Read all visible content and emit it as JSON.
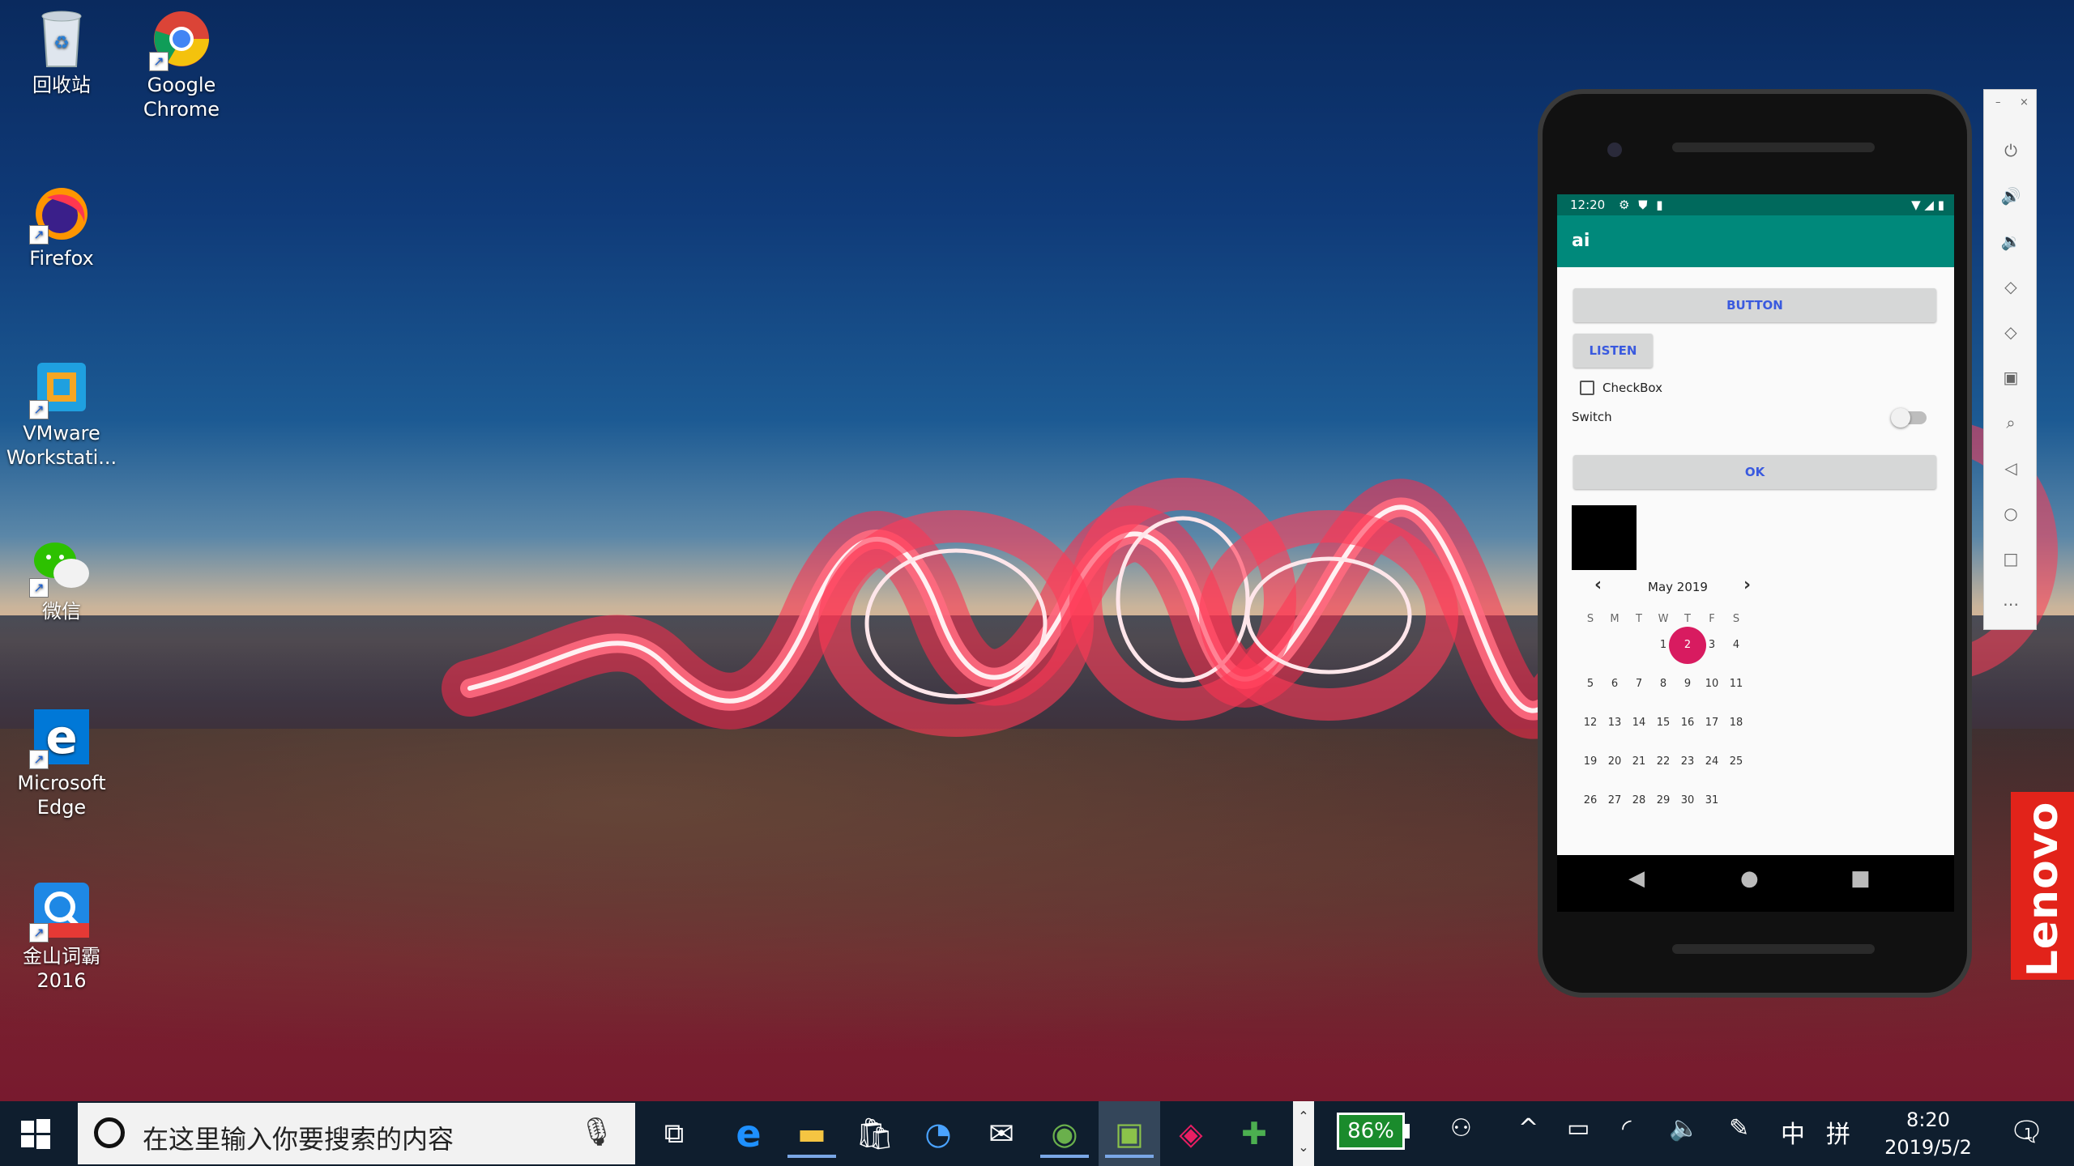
{
  "desktop": {
    "icons": [
      {
        "label": "回收站"
      },
      {
        "label": "Google Chrome"
      },
      {
        "label": "Firefox"
      },
      {
        "label": "VMware Workstati..."
      },
      {
        "label": "微信"
      },
      {
        "label": "Microsoft Edge"
      },
      {
        "label": "金山词霸 2016"
      }
    ]
  },
  "phone": {
    "status_time": "12:20",
    "app_title": "ai",
    "button_label": "BUTTON",
    "listen_label": "LISTEN",
    "checkbox_label": "CheckBox",
    "switch_label": "Switch",
    "ok_label": "OK",
    "calendar": {
      "month_title": "May 2019",
      "weekdays": [
        "S",
        "M",
        "T",
        "W",
        "T",
        "F",
        "S"
      ],
      "selected_day": "2",
      "days": [
        "1",
        "2",
        "3",
        "4",
        "5",
        "6",
        "7",
        "8",
        "9",
        "10",
        "11",
        "12",
        "13",
        "14",
        "15",
        "16",
        "17",
        "18",
        "19",
        "20",
        "21",
        "22",
        "23",
        "24",
        "25",
        "26",
        "27",
        "28",
        "29",
        "30",
        "31"
      ],
      "first_weekday_index": 3
    }
  },
  "brand": {
    "lenovo": "Lenovo"
  },
  "taskbar": {
    "search_placeholder": "在这里输入你要搜索的内容",
    "battery_percent": "86%",
    "ime_lang": "中",
    "ime_mode": "拼",
    "time": "8:20",
    "date": "2019/5/2",
    "notification_count": "1"
  },
  "colors": {
    "app_bar": "#00897b",
    "status_bar": "#00695c",
    "selected_day": "#d81b60",
    "button_text": "#3a5adf",
    "taskbar": "#0f1e2e",
    "battery": "#1a8b2c"
  }
}
